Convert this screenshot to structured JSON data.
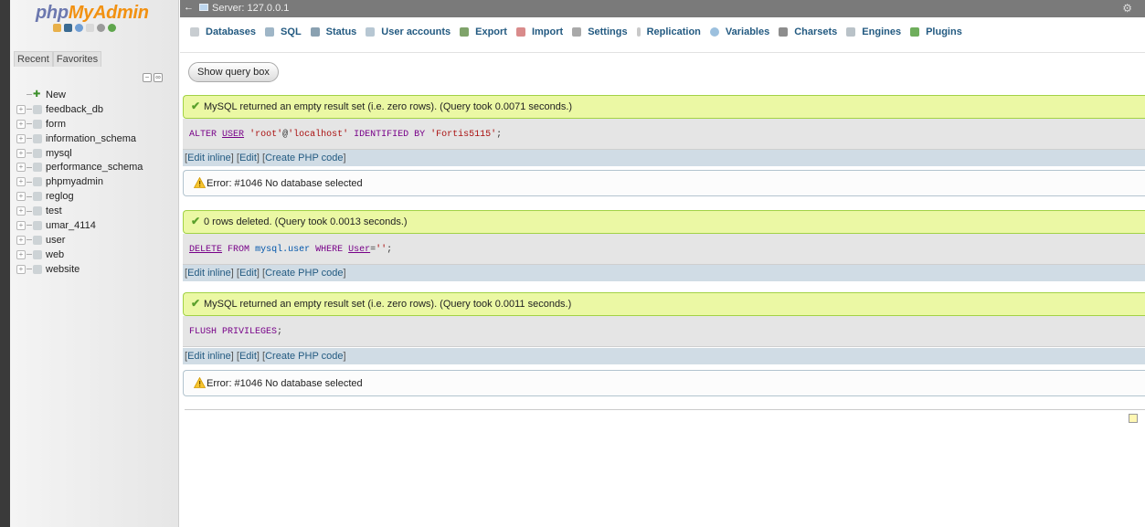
{
  "nav": {
    "logo_php": "php",
    "logo_myadmin": "MyAdmin",
    "tab_recent": "Recent",
    "tab_favorites": "Favorites",
    "collapse_symbol": "−",
    "link_symbol": "∞",
    "tree": [
      {
        "label": "New",
        "kind": "new"
      },
      {
        "label": "feedback_db",
        "kind": "db"
      },
      {
        "label": "form",
        "kind": "db"
      },
      {
        "label": "information_schema",
        "kind": "db"
      },
      {
        "label": "mysql",
        "kind": "db"
      },
      {
        "label": "performance_schema",
        "kind": "db"
      },
      {
        "label": "phpmyadmin",
        "kind": "db"
      },
      {
        "label": "reglog",
        "kind": "db"
      },
      {
        "label": "test",
        "kind": "db"
      },
      {
        "label": "umar_4114",
        "kind": "db"
      },
      {
        "label": "user",
        "kind": "db"
      },
      {
        "label": "web",
        "kind": "db"
      },
      {
        "label": "website",
        "kind": "db"
      }
    ]
  },
  "serverbar": {
    "collapse": "←",
    "server": "Server: 127.0.0.1",
    "gear": "⚙"
  },
  "menu": [
    {
      "label": "Databases",
      "icon": "database-icon",
      "color": "#c8cdd1"
    },
    {
      "label": "SQL",
      "icon": "sql-icon",
      "color": "#9fb6c7"
    },
    {
      "label": "Status",
      "icon": "status-icon",
      "color": "#8aa1b1"
    },
    {
      "label": "User accounts",
      "icon": "users-icon",
      "color": "#b7c7d3"
    },
    {
      "label": "Export",
      "icon": "export-icon",
      "color": "#7fa36a"
    },
    {
      "label": "Import",
      "icon": "import-icon",
      "color": "#d98b8b"
    },
    {
      "label": "Settings",
      "icon": "wrench-icon",
      "color": "#a9a9a9"
    },
    {
      "label": "Replication",
      "icon": "replication-icon",
      "color": "#c9c9c9"
    },
    {
      "label": "Variables",
      "icon": "variables-icon",
      "color": "#9cc0de"
    },
    {
      "label": "Charsets",
      "icon": "charsets-icon",
      "color": "#8d8d8d"
    },
    {
      "label": "Engines",
      "icon": "engines-icon",
      "color": "#b9c2c8"
    },
    {
      "label": "Plugins",
      "icon": "plugins-icon",
      "color": "#6fae5c"
    }
  ],
  "main": {
    "show_query_box": "Show query box",
    "check": "✔",
    "results": [
      {
        "success": "MySQL returned an empty result set (i.e. zero rows). (Query took 0.0071 seconds.)"
      },
      {
        "error": "Error: #1046 No database selected"
      },
      {
        "success": "0 rows deleted. (Query took 0.0013 seconds.)"
      },
      {
        "success": "MySQL returned an empty result set (i.e. zero rows). (Query took 0.0011 seconds.)"
      },
      {
        "error": "Error: #1046 No database selected"
      }
    ],
    "sql1": {
      "p1": "ALTER",
      "p2": "USER",
      "p3": "'root'",
      "p4": "@",
      "p5": "'localhost'",
      "p6": "IDENTIFIED BY",
      "p7": "'Fortis5115'",
      "p8": ";"
    },
    "sql2": {
      "p1": "DELETE",
      "p2": "FROM",
      "p3": "mysql.user",
      "p4": "WHERE",
      "p5": "User",
      "p6": "=",
      "p7": "''",
      "p8": ";"
    },
    "sql3": {
      "p1": "FLUSH PRIVILEGES",
      "p2": ";"
    },
    "links": {
      "bracket_open": "[",
      "bracket_close": "]",
      "edit_inline": "Edit inline",
      "edit": "Edit",
      "create_php": "Create PHP code"
    }
  }
}
